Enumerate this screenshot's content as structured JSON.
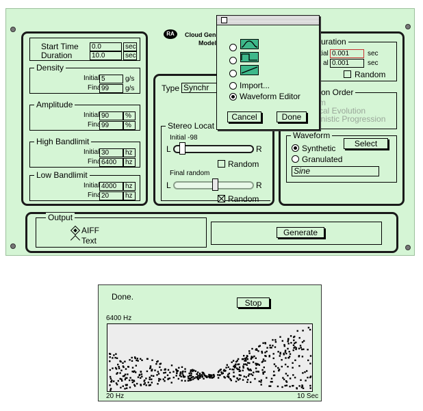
{
  "header": {
    "logo_text": "RA",
    "title_line1": "Cloud Gene",
    "title_line2": "Model"
  },
  "time": {
    "start_label": "Start Time",
    "start_value": "0.0",
    "start_unit": "sec",
    "duration_label": "Duration",
    "duration_value": "10.0",
    "duration_unit": "sec"
  },
  "density": {
    "title": "Density",
    "initial_label": "Initial",
    "initial_value": "5",
    "final_label": "Final",
    "final_value": "99",
    "unit": "g/s"
  },
  "amplitude": {
    "title": "Amplitude",
    "initial_label": "Initial",
    "initial_value": "90",
    "final_label": "Final",
    "final_value": "99",
    "unit": "%"
  },
  "high_bandlimit": {
    "title": "High Bandlimit",
    "initial_label": "Initial",
    "initial_value": "30",
    "final_label": "Final",
    "final_value": "6400",
    "unit": "hz"
  },
  "low_bandlimit": {
    "title": "Low Bandlimit",
    "initial_label": "Initial",
    "initial_value": "4000",
    "final_label": "Final",
    "final_value": "20",
    "unit": "hz"
  },
  "type": {
    "label": "Type",
    "value": "Synchr"
  },
  "stereo": {
    "title": "Stereo Locat",
    "initial_label": "Initial -98",
    "final_label": "Final  random",
    "left": "L",
    "right": "R",
    "random_label": "Random",
    "initial_level": 0.05,
    "final_level": 0.5,
    "initial_random": false,
    "final_random": true
  },
  "grain_duration": {
    "title": "uration",
    "initial_prefix": "tial",
    "initial_value": "0.001",
    "final_prefix": "al",
    "final_value": "0.001",
    "unit": "sec",
    "random_label": "Random"
  },
  "selection_order": {
    "title": "on Order",
    "opt1": "m",
    "opt2": "cal Evolution",
    "opt3": "inistic Progression"
  },
  "waveform": {
    "title": "Waveform",
    "synthetic_label": "Synthetic",
    "granulated_label": "Granulated",
    "select_label": "Select",
    "selected_value": "Sine"
  },
  "output": {
    "title": "Output",
    "aiff_label": "AIFF",
    "text_label": "Text"
  },
  "generate_label": "Generate",
  "popup": {
    "import_label": "Import...",
    "editor_label": "Waveform Editor",
    "cancel_label": "Cancel",
    "done_label": "Done"
  },
  "status": {
    "message": "Done.",
    "stop_label": "Stop"
  },
  "chart_data": {
    "type": "scatter",
    "title": "",
    "xlabel": "",
    "ylabel": "",
    "y_top_label": "6400 Hz",
    "y_bottom_label": "20 Hz",
    "x_right_label": "10 Sec",
    "xlim": [
      0,
      10
    ],
    "ylim": [
      20,
      6400
    ],
    "envelope": {
      "x": [
        0,
        2.5,
        5,
        7.5,
        10
      ],
      "high": [
        4000,
        3000,
        1600,
        4800,
        6400
      ],
      "low": [
        30,
        600,
        1300,
        500,
        20
      ]
    },
    "point_count": 520
  },
  "colors": {
    "panel_bg": "#d5f5d5",
    "plot_bg": "#ededed",
    "dots": "#000000"
  }
}
